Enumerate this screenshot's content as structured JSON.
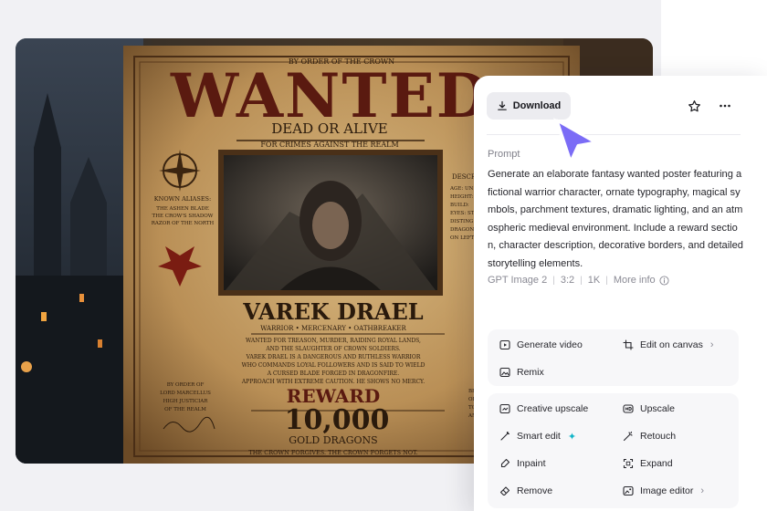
{
  "poster": {
    "decree": "BY ORDER OF THE CROWN",
    "headline": "WANTED",
    "status": "DEAD OR ALIVE",
    "charge": "FOR CRIMES AGAINST THE REALM",
    "aliases_title": "KNOWN ALIASES:",
    "aliases": [
      "THE ASHEN BLADE",
      "THE CROW'S SHADOW",
      "RAZOR OF THE NORTH"
    ],
    "desc_title": "DESCR",
    "desc_lines": [
      "AGE: UN",
      "HEIGHT:",
      "BUILD:",
      "EYES: ST",
      "DISTING",
      "DRAGON",
      "ON LEFT"
    ],
    "name": "VAREK DRAEL",
    "roles": "WARRIOR • MERCENARY • OATHBREAKER",
    "crimes": [
      "WANTED FOR TREASON, MURDER, RAIDING ROYAL LANDS,",
      "AND THE SLAUGHTER OF CROWN SOLDIERS.",
      "VAREK DRAEL IS A DANGEROUS AND RUTHLESS WARRIOR",
      "WHO COMMANDS LOYAL FOLLOWERS AND IS SAID TO WIELD",
      "A CURSED BLADE FORGED IN DRAGONFIRE.",
      "APPROACH WITH EXTREME CAUTION. HE SHOWS NO MERCY."
    ],
    "order_lines": [
      "BY ORDER OF",
      "LORD MARCELLUS",
      "HIGH JUSTICIAR",
      "OF THE REALM"
    ],
    "right_lines": [
      "BRING",
      "OF HIS",
      "TO THE",
      "AND C"
    ],
    "reward_title": "REWARD",
    "reward_amount": "10,000",
    "reward_unit": "GOLD DRAGONS",
    "footer": "THE CROWN FORGIVES. THE CROWN FORGETS NOT."
  },
  "panel": {
    "download_label": "Download",
    "prompt_heading": "Prompt",
    "prompt_text": "Generate an elaborate fantasy wanted poster featuring a fictional warrior character, ornate typography, magical symbols, parchment textures, dramatic lighting, and an atmospheric medieval environment. Include a reward section, character description, decorative borders, and detailed storytelling elements.",
    "meta": {
      "model": "GPT Image 2",
      "ratio": "3:2",
      "resolution": "1K",
      "more_info": "More info"
    },
    "actions_primary": {
      "generate_video": "Generate video",
      "edit_on_canvas": "Edit on canvas",
      "remix": "Remix"
    },
    "actions_tools": {
      "creative_upscale": "Creative upscale",
      "upscale": "Upscale",
      "smart_edit": "Smart edit",
      "retouch": "Retouch",
      "inpaint": "Inpaint",
      "expand": "Expand",
      "remove": "Remove",
      "image_editor": "Image editor"
    }
  },
  "colors": {
    "cursor": "#7b6cf6",
    "accent_sparkle": "#12b5c8",
    "panel_bg": "#ffffff",
    "group_bg": "#f7f7f9"
  }
}
